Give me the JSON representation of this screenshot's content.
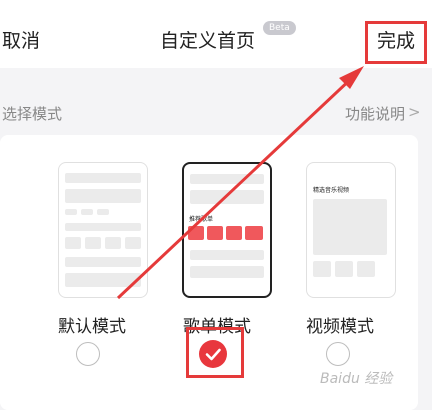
{
  "header": {
    "cancel_label": "取消",
    "title": "自定义首页",
    "beta_badge": "Beta",
    "done_label": "完成"
  },
  "section": {
    "label": "选择模式",
    "help_link": "功能说明",
    "help_chevron": ">"
  },
  "modes": [
    {
      "label": "默认模式",
      "selected": false
    },
    {
      "label": "歌单模式",
      "selected": true,
      "preview_text": "推荐歌单"
    },
    {
      "label": "视频模式",
      "selected": false,
      "preview_text": "精选音乐视频"
    }
  ],
  "watermark": "Baidu 经验",
  "colors": {
    "accent": "#e8373d",
    "annotation": "#e53a3a",
    "background": "#f4f4f6"
  }
}
